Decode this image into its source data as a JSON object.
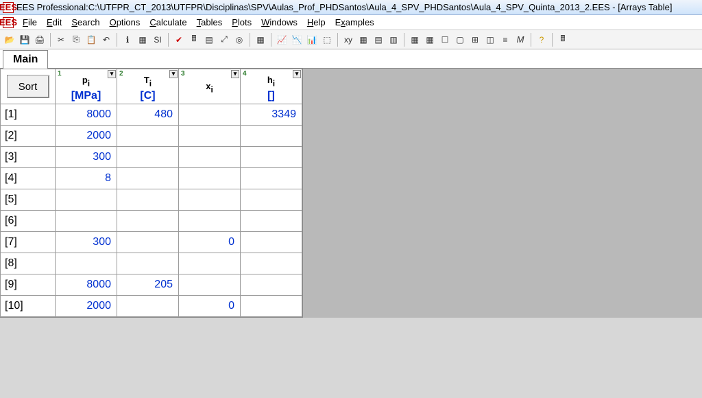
{
  "title_prefix": "EES Professional:  ",
  "title_path": "C:\\UTFPR_CT_2013\\UTFPR\\Disciplinas\\SPV\\Aulas_Prof_PHDSantos\\Aula_4_SPV_PHDSantos\\Aula_4_SPV_Quinta_2013_2.EES - [Arrays Table]",
  "app_icon_text": "EES",
  "menus": {
    "file": "File",
    "edit": "Edit",
    "search": "Search",
    "options": "Options",
    "calculate": "Calculate",
    "tables": "Tables",
    "plots": "Plots",
    "windows": "Windows",
    "help": "Help",
    "examples": "Examples"
  },
  "tab_main": "Main",
  "sort_label": "Sort",
  "columns": [
    {
      "num": "1",
      "var": "p",
      "sub": "i",
      "unit": "[MPa]"
    },
    {
      "num": "2",
      "var": "T",
      "sub": "i",
      "unit": "[C]"
    },
    {
      "num": "3",
      "var": "x",
      "sub": "i",
      "unit": ""
    },
    {
      "num": "4",
      "var": "h",
      "sub": "i",
      "unit": "[]"
    }
  ],
  "rows": [
    {
      "label": "[1]",
      "cells": [
        "8000",
        "480",
        "",
        "3349"
      ]
    },
    {
      "label": "[2]",
      "cells": [
        "2000",
        "",
        "",
        ""
      ]
    },
    {
      "label": "[3]",
      "cells": [
        "300",
        "",
        "",
        ""
      ]
    },
    {
      "label": "[4]",
      "cells": [
        "8",
        "",
        "",
        ""
      ]
    },
    {
      "label": "[5]",
      "cells": [
        "",
        "",
        "",
        ""
      ]
    },
    {
      "label": "[6]",
      "cells": [
        "",
        "",
        "",
        ""
      ]
    },
    {
      "label": "[7]",
      "cells": [
        "300",
        "",
        "0",
        ""
      ]
    },
    {
      "label": "[8]",
      "cells": [
        "",
        "",
        "",
        ""
      ]
    },
    {
      "label": "[9]",
      "cells": [
        "8000",
        "205",
        "",
        ""
      ]
    },
    {
      "label": "[10]",
      "cells": [
        "2000",
        "",
        "0",
        ""
      ]
    }
  ],
  "chart_data": {
    "type": "table",
    "title": "Arrays Table",
    "columns": [
      "p_i [MPa]",
      "T_i [C]",
      "x_i",
      "h_i []"
    ],
    "rows": [
      [
        8000,
        480,
        null,
        3349
      ],
      [
        2000,
        null,
        null,
        null
      ],
      [
        300,
        null,
        null,
        null
      ],
      [
        8,
        null,
        null,
        null
      ],
      [
        null,
        null,
        null,
        null
      ],
      [
        null,
        null,
        null,
        null
      ],
      [
        300,
        null,
        0,
        null
      ],
      [
        null,
        null,
        null,
        null
      ],
      [
        8000,
        205,
        null,
        null
      ],
      [
        2000,
        null,
        0,
        null
      ]
    ]
  }
}
